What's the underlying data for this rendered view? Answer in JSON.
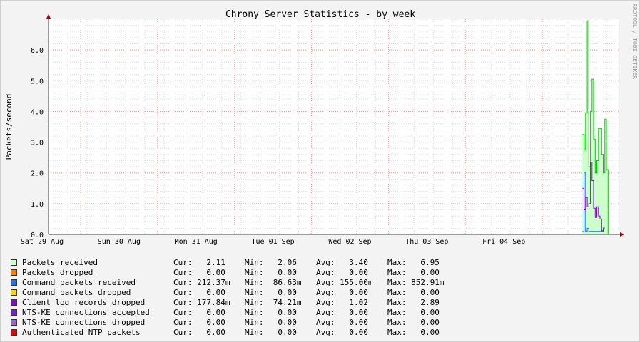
{
  "chart_data": {
    "type": "area",
    "title": "Chrony Server Statistics - by week",
    "ylabel": "Packets/second",
    "xlabel": "",
    "watermark": "RRDTOOL / TOBI OETIKER",
    "ylim": [
      0,
      7
    ],
    "yticks": [
      "0.0",
      "1.0",
      "2.0",
      "3.0",
      "4.0",
      "5.0",
      "6.0"
    ],
    "x_start_hours": 0,
    "x_end_hours": 168,
    "xticks": [
      {
        "label": "Sat 29 Aug",
        "day_center": 0
      },
      {
        "label": "Sun 30 Aug",
        "day_center": 1
      },
      {
        "label": "Mon 31 Aug",
        "day_center": 2
      },
      {
        "label": "Tue 01 Sep",
        "day_center": 3
      },
      {
        "label": "Wed 02 Sep",
        "day_center": 4
      },
      {
        "label": "Thu 03 Sep",
        "day_center": 5
      },
      {
        "label": "Fri 04 Sep",
        "day_center": 6
      }
    ],
    "grid": true,
    "series": [
      {
        "name": "Packets received",
        "color": "#00cc00",
        "fill": "#ccffcc",
        "style": "area",
        "x_hours": [
          166.5,
          167,
          167.5,
          168,
          168.5,
          169,
          169.5,
          170,
          170.5,
          171,
          171.5,
          172,
          172.5,
          173,
          173.5,
          174,
          174.5,
          175,
          175.5,
          176,
          176.5,
          177
        ],
        "values": [
          3.25,
          2.75,
          3.95,
          6.95,
          2.2,
          4.0,
          5.05,
          3.1,
          2.0,
          2.4,
          3.45,
          3.45,
          2.6,
          2.0,
          3.75,
          2.11,
          0,
          0,
          0,
          0,
          0,
          0
        ]
      },
      {
        "name": "Packets dropped",
        "color": "#ff7f00",
        "style": "line",
        "x_hours": [],
        "values": []
      },
      {
        "name": "Command packets received",
        "color": "#2a6ed8",
        "style": "line",
        "x_hours": [
          166.5,
          167,
          167.5,
          168,
          168.5,
          169,
          169.5,
          170,
          170.5,
          171,
          171.5,
          172,
          172.5,
          173
        ],
        "values": [
          0.1,
          2.0,
          0.1,
          0.2,
          0.1,
          0.1,
          0.1,
          0.1,
          0.1,
          0.1,
          0.1,
          0.1,
          0.1,
          0.21
        ]
      },
      {
        "name": "Command packets dropped",
        "color": "#ffd700",
        "style": "line",
        "x_hours": [],
        "values": []
      },
      {
        "name": "Client log records dropped",
        "color": "#7e0fbf",
        "style": "line",
        "x_hours": [
          166.5,
          167,
          167.5,
          168,
          168.5,
          169,
          169.5,
          170,
          170.5,
          171,
          171.5,
          172,
          172.5,
          173
        ],
        "values": [
          1.5,
          0.8,
          1.2,
          0.9,
          1.0,
          2.35,
          1.75,
          0.85,
          0.55,
          0.9,
          0.6,
          0.5,
          0.12,
          0.18
        ]
      },
      {
        "name": "NTS-KE connections accepted",
        "color": "#7722cc",
        "style": "line",
        "x_hours": [],
        "values": []
      },
      {
        "name": "NTS-KE connections dropped",
        "color": "#9966cc",
        "style": "line",
        "x_hours": [],
        "values": []
      },
      {
        "name": "Authenticated NTP packets",
        "color": "#ee0000",
        "style": "line",
        "x_hours": [],
        "values": []
      }
    ]
  },
  "legend": [
    {
      "name": "Packets received",
      "color": "#ccffcc",
      "cur": "Cur:   2.11",
      "min": "Min:   2.06",
      "avg": "Avg:   3.40",
      "max": "Max:   6.95"
    },
    {
      "name": "Packets dropped",
      "color": "#ff7f00",
      "cur": "Cur:   0.00",
      "min": "Min:   0.00",
      "avg": "Avg:   0.00",
      "max": "Max:   0.00"
    },
    {
      "name": "Command packets received",
      "color": "#2a6ed8",
      "cur": "Cur: 212.37m",
      "min": "Min:  86.63m",
      "avg": "Avg: 155.00m",
      "max": "Max: 852.91m"
    },
    {
      "name": "Command packets dropped",
      "color": "#ffd700",
      "cur": "Cur:   0.00",
      "min": "Min:   0.00",
      "avg": "Avg:   0.00",
      "max": "Max:   0.00"
    },
    {
      "name": "Client log records dropped",
      "color": "#7e0fbf",
      "cur": "Cur: 177.84m",
      "min": "Min:  74.21m",
      "avg": "Avg:   1.02",
      "max": "Max:   2.89"
    },
    {
      "name": "NTS-KE connections accepted",
      "color": "#7722cc",
      "cur": "Cur:   0.00",
      "min": "Min:   0.00",
      "avg": "Avg:   0.00",
      "max": "Max:   0.00"
    },
    {
      "name": "NTS-KE connections dropped",
      "color": "#9966cc",
      "cur": "Cur:   0.00",
      "min": "Min:   0.00",
      "avg": "Avg:   0.00",
      "max": "Max:   0.00"
    },
    {
      "name": "Authenticated NTP packets",
      "color": "#ee0000",
      "cur": "Cur:   0.00",
      "min": "Min:   0.00",
      "avg": "Avg:   0.00",
      "max": "Max:   0.00"
    }
  ]
}
